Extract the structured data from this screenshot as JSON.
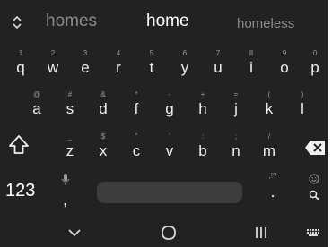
{
  "suggestions": {
    "left": "homes",
    "center": "home",
    "right": "homeless"
  },
  "icons": {
    "expand": "chevron-up-down-icon",
    "shift": "shift-icon",
    "backspace": "backspace-icon",
    "mic": "microphone-icon",
    "emoji": "emoji-icon",
    "search": "search-icon",
    "nav_back": "chevron-down-icon",
    "nav_home": "home-circle-icon",
    "nav_recents": "recents-icon",
    "nav_keyboard": "keyboard-icon"
  },
  "rows": {
    "top": [
      {
        "hint": "1",
        "char": "q"
      },
      {
        "hint": "2",
        "char": "w"
      },
      {
        "hint": "3",
        "char": "e"
      },
      {
        "hint": "4",
        "char": "r"
      },
      {
        "hint": "5",
        "char": "t"
      },
      {
        "hint": "6",
        "char": "y"
      },
      {
        "hint": "7",
        "char": "u"
      },
      {
        "hint": "8",
        "char": "i"
      },
      {
        "hint": "9",
        "char": "o"
      },
      {
        "hint": "0",
        "char": "p"
      }
    ],
    "middle": [
      {
        "hint": "@",
        "char": "a"
      },
      {
        "hint": "#",
        "char": "s"
      },
      {
        "hint": "&",
        "char": "d"
      },
      {
        "hint": "*",
        "char": "f"
      },
      {
        "hint": "-",
        "char": "g"
      },
      {
        "hint": "+",
        "char": "h"
      },
      {
        "hint": "=",
        "char": "j"
      },
      {
        "hint": "(",
        "char": "k"
      },
      {
        "hint": ")",
        "char": "l"
      }
    ],
    "bottom": [
      {
        "hint": "_",
        "char": "z"
      },
      {
        "hint": "$",
        "char": "x"
      },
      {
        "hint": "\"",
        "char": "c"
      },
      {
        "hint": "'",
        "char": "v"
      },
      {
        "hint": ":",
        "char": "b"
      },
      {
        "hint": ";",
        "char": "n"
      },
      {
        "hint": "/",
        "char": "m"
      }
    ]
  },
  "bottom_bar": {
    "numbers_label": "123",
    "comma": ",",
    "period": ".",
    "period_hint": ",!?"
  },
  "colors": {
    "background": "#222222",
    "key_text": "#f0f0f0",
    "hint_text": "#9a9a9a",
    "space_bar": "#3d3d3d",
    "suggestion_muted": "#8c8c8c"
  }
}
